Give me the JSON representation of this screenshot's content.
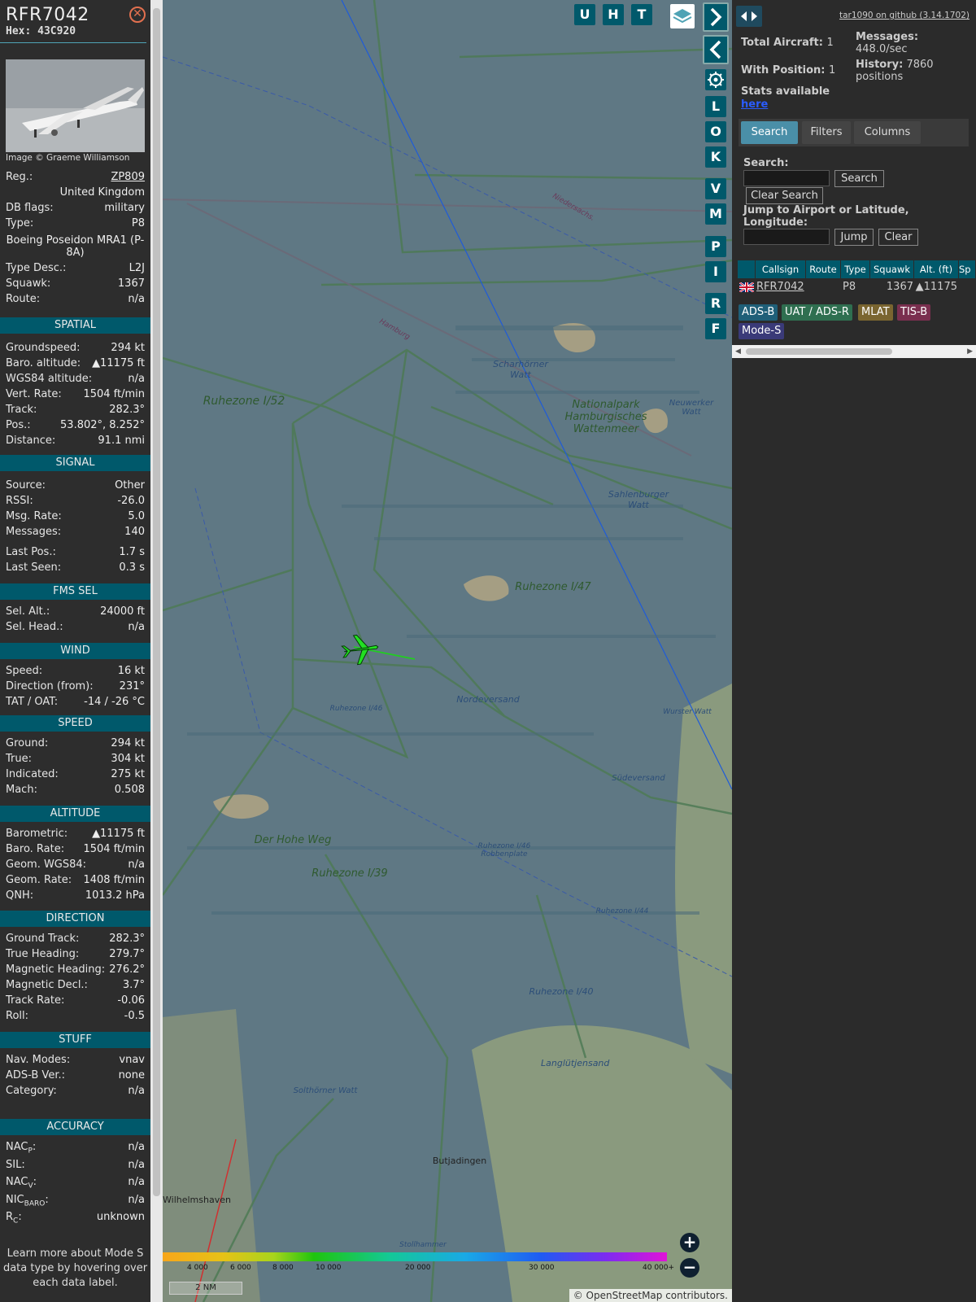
{
  "aircraft": {
    "callsign": "RFR7042",
    "hex_label": "Hex:",
    "hex": "43C920",
    "photo_credit": "Image © Graeme Williamson"
  },
  "details": [
    {
      "k": "Reg.:",
      "v": "ZP809"
    },
    {
      "k": "",
      "v": "United Kingdom"
    },
    {
      "k": "DB flags:",
      "v": "military"
    },
    {
      "k": "Type:",
      "v": "P8"
    },
    {
      "k": "",
      "v": "Boeing Poseidon MRA1 (P-8A)"
    },
    {
      "k": "Type Desc.:",
      "v": "L2J"
    },
    {
      "k": "Squawk:",
      "v": "1367"
    },
    {
      "k": "Route:",
      "v": "n/a"
    }
  ],
  "sections": {
    "spatial": "SPATIAL",
    "signal": "SIGNAL",
    "fms": "FMS SEL",
    "wind": "WIND",
    "speed": "SPEED",
    "altitude": "ALTITUDE",
    "direction": "DIRECTION",
    "stuff": "STUFF",
    "accuracy": "ACCURACY"
  },
  "spatial": [
    {
      "k": "Groundspeed:",
      "v": "294 kt"
    },
    {
      "k": "Baro. altitude:",
      "v": "▲11175 ft"
    },
    {
      "k": "WGS84 altitude:",
      "v": "n/a"
    },
    {
      "k": "Vert. Rate:",
      "v": "1504 ft/min"
    },
    {
      "k": "Track:",
      "v": "282.3°"
    },
    {
      "k": "Pos.:",
      "v": "53.802°, 8.252°"
    },
    {
      "k": "Distance:",
      "v": "91.1 nmi"
    }
  ],
  "signal": [
    {
      "k": "Source:",
      "v": "Other"
    },
    {
      "k": "RSSI:",
      "v": "-26.0"
    },
    {
      "k": "Msg. Rate:",
      "v": "5.0"
    },
    {
      "k": "Messages:",
      "v": "140"
    },
    {
      "k": "Last Pos.:",
      "v": "1.7 s"
    },
    {
      "k": "Last Seen:",
      "v": "0.3 s"
    }
  ],
  "fms": [
    {
      "k": "Sel. Alt.:",
      "v": "24000 ft"
    },
    {
      "k": "Sel. Head.:",
      "v": "n/a"
    }
  ],
  "wind": [
    {
      "k": "Speed:",
      "v": "16 kt"
    },
    {
      "k": "Direction (from):",
      "v": "231°"
    },
    {
      "k": "TAT / OAT:",
      "v": "-14 / -26 °C"
    }
  ],
  "speed": [
    {
      "k": "Ground:",
      "v": "294 kt"
    },
    {
      "k": "True:",
      "v": "304 kt"
    },
    {
      "k": "Indicated:",
      "v": "275 kt"
    },
    {
      "k": "Mach:",
      "v": "0.508"
    }
  ],
  "altitude": [
    {
      "k": "Barometric:",
      "v": "▲11175 ft"
    },
    {
      "k": "Baro. Rate:",
      "v": "1504 ft/min"
    },
    {
      "k": "Geom. WGS84:",
      "v": "n/a"
    },
    {
      "k": "Geom. Rate:",
      "v": "1408 ft/min"
    },
    {
      "k": "QNH:",
      "v": "1013.2 hPa"
    }
  ],
  "direction": [
    {
      "k": "Ground Track:",
      "v": "282.3°"
    },
    {
      "k": "True Heading:",
      "v": "279.7°"
    },
    {
      "k": "Magnetic Heading:",
      "v": "276.2°"
    },
    {
      "k": "Magnetic Decl.:",
      "v": "3.7°"
    },
    {
      "k": "Track Rate:",
      "v": "-0.06"
    },
    {
      "k": "Roll:",
      "v": "-0.5"
    }
  ],
  "stuff": [
    {
      "k": "Nav. Modes:",
      "v": "vnav"
    },
    {
      "k": "ADS-B Ver.:",
      "v": "none"
    },
    {
      "k": "Category:",
      "v": "n/a"
    }
  ],
  "accuracy": [
    {
      "k": "NAC",
      "sub": "P",
      "v": "n/a"
    },
    {
      "k": "SIL:",
      "sub": "",
      "v": "n/a"
    },
    {
      "k": "NAC",
      "sub": "V",
      "v": "n/a"
    },
    {
      "k": "NIC",
      "sub": "BARO",
      "v": "n/a"
    },
    {
      "k": "R",
      "sub": "C",
      "v": "unknown"
    }
  ],
  "learn_more": "Learn more about Mode S data type by hovering over each data label.",
  "map": {
    "buttons": [
      "U",
      "H",
      "T"
    ],
    "side_buttons": [
      "L",
      "O",
      "K",
      "V",
      "M",
      "P",
      "I",
      "R",
      "F"
    ],
    "labels": [
      {
        "t": "Ruhezone I/52"
      },
      {
        "t": "Scharhörner Watt"
      },
      {
        "t": "Nationalpark Hamburgisches Wattenmeer"
      },
      {
        "t": "Neuwerker Watt"
      },
      {
        "t": "Sahlenburger Watt"
      },
      {
        "t": "Ruhezone I/47"
      },
      {
        "t": "Nordeversand"
      },
      {
        "t": "Ruhezone I/46"
      },
      {
        "t": "Wurster Watt"
      },
      {
        "t": "Südeversand"
      },
      {
        "t": "Der Hohe Weg"
      },
      {
        "t": "Ruhezone I/39"
      },
      {
        "t": "Ruhezone I/46 Robbenplate"
      },
      {
        "t": "Ruhezone I/44"
      },
      {
        "t": "Ruhezone I/40"
      },
      {
        "t": "Langlütjensand"
      },
      {
        "t": "Solthörner Watt"
      },
      {
        "t": "Butjadingen"
      },
      {
        "t": "Wilhelmshaven"
      },
      {
        "t": "Hamburg"
      },
      {
        "t": "Niedersachs."
      },
      {
        "t": "Stollhammer"
      }
    ],
    "legend_ticks": [
      "4 000",
      "6 000",
      "8 000",
      "10 000",
      "20 000",
      "30 000",
      "40 000+"
    ],
    "scale": "2 NM",
    "attribution": "© OpenStreetMap contributors."
  },
  "panel": {
    "github": "tar1090 on github (3.14.1702)",
    "total_label": "Total Aircraft:",
    "total": "1",
    "messages_label": "Messages:",
    "messages": "448.0/sec",
    "with_pos_label": "With Position:",
    "with_pos": "1",
    "history_label": "History:",
    "history": "7860 positions",
    "stats_label": "Stats available",
    "stats_link": "here",
    "tabs": [
      "Search",
      "Filters",
      "Columns"
    ],
    "search_label": "Search:",
    "search_btn": "Search",
    "clear_search_btn": "Clear Search",
    "jump_label": "Jump to Airport or Latitude, Longitude:",
    "jump_btn": "Jump",
    "clear_btn": "Clear",
    "columns": [
      "Callsign",
      "Route",
      "Type",
      "Squawk",
      "Alt. (ft)",
      "Sp"
    ],
    "row": {
      "callsign": "RFR7042",
      "route": "",
      "type": "P8",
      "squawk": "1367",
      "alt": "▲11175"
    },
    "badges": [
      {
        "t": "ADS-B",
        "c": "#1f5f78"
      },
      {
        "t": "UAT / ADS-R",
        "c": "#2f6f50"
      },
      {
        "t": "MLAT",
        "c": "#7a6530"
      },
      {
        "t": "TIS-B",
        "c": "#7a2f4f"
      },
      {
        "t": "Mode-S",
        "c": "#3a3a78"
      }
    ]
  }
}
